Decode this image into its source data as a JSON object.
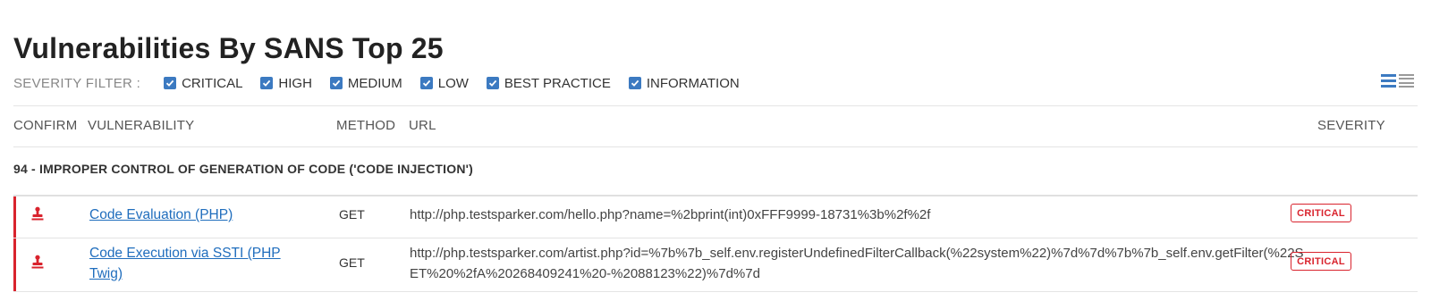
{
  "page": {
    "title": "Vulnerabilities By SANS Top 25"
  },
  "filter": {
    "label": "SEVERITY FILTER :",
    "options": [
      {
        "label": "CRITICAL",
        "checked": true
      },
      {
        "label": "HIGH",
        "checked": true
      },
      {
        "label": "MEDIUM",
        "checked": true
      },
      {
        "label": "LOW",
        "checked": true
      },
      {
        "label": "BEST PRACTICE",
        "checked": true
      },
      {
        "label": "INFORMATION",
        "checked": true
      }
    ]
  },
  "view_toggle": {
    "icons": [
      "list-view-icon",
      "compact-view-icon"
    ]
  },
  "table": {
    "headers": {
      "confirm": "CONFIRM",
      "vulnerability": "VULNERABILITY",
      "method": "METHOD",
      "url": "URL",
      "severity": "SEVERITY"
    },
    "group": "94 - IMPROPER CONTROL OF GENERATION OF CODE ('CODE INJECTION')",
    "rows": [
      {
        "confirm_icon": "confirmed-stamp-icon",
        "vulnerability": "Code Evaluation (PHP)",
        "method": "GET",
        "url": "http://php.testsparker.com/hello.php?name=%2bprint(int)0xFFF9999-18731%3b%2f%2f",
        "severity": "CRITICAL"
      },
      {
        "confirm_icon": "confirmed-stamp-icon",
        "vulnerability": "Code Execution via SSTI (PHP Twig)",
        "method": "GET",
        "url": "http://php.testsparker.com/artist.php?id=%7b%7b_self.env.registerUndefinedFilterCallback(%22system%22)%7d%7d%7b%7b_self.env.getFilter(%22SET%20%2fA%20268409241%20-%2088123%22)%7d%7d",
        "severity": "CRITICAL"
      }
    ]
  },
  "colors": {
    "accent": "#3c7ac1",
    "critical": "#d9232d",
    "link": "#1f6dbd"
  }
}
